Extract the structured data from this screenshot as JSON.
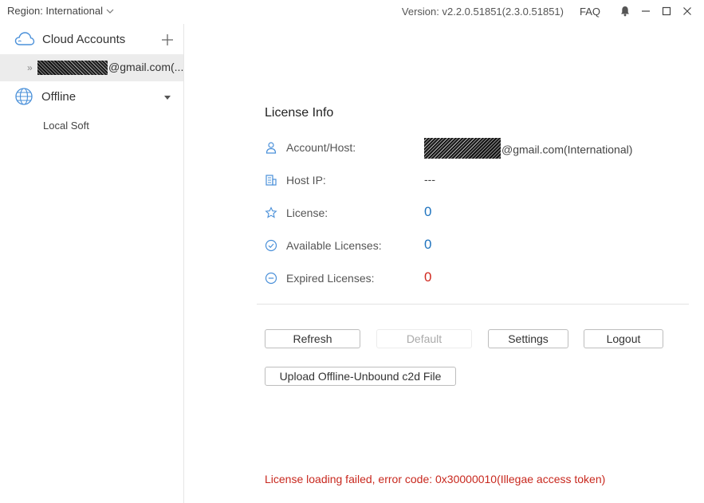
{
  "topbar": {
    "region_label": "Region: International",
    "version_label": "Version: v2.2.0.51851(2.3.0.51851)",
    "faq_label": "FAQ"
  },
  "sidebar": {
    "cloud_accounts_label": "Cloud Accounts",
    "account_email_suffix": "@gmail.com(...",
    "offline_label": "Offline",
    "local_soft_label": "Local Soft"
  },
  "license_info": {
    "title": "License Info",
    "rows": [
      {
        "label": "Account/Host:",
        "value": "@gmail.com(International)"
      },
      {
        "label": "Host IP:",
        "value": "---"
      },
      {
        "label": "License:",
        "value": "0"
      },
      {
        "label": "Available Licenses:",
        "value": "0"
      },
      {
        "label": "Expired Licenses:",
        "value": "0"
      }
    ]
  },
  "buttons": {
    "refresh": "Refresh",
    "default": "Default",
    "settings": "Settings",
    "logout": "Logout",
    "upload": "Upload Offline-Unbound c2d File"
  },
  "error_message": "License loading failed, error code: 0x30000010(Illegae access token)",
  "colors": {
    "value_blue": "#1e73be",
    "value_red": "#d0281e",
    "error_red": "#c8281e",
    "icon_blue": "#4a90d9"
  },
  "icons": {
    "cloud": "cloud-icon",
    "globe": "globe-icon",
    "bell": "bell-icon",
    "minimize": "minimize-icon",
    "maximize": "maximize-icon",
    "close": "close-icon",
    "user": "user-icon",
    "building": "building-icon",
    "star": "star-icon",
    "check_circle": "check-circle-icon",
    "minus_circle": "minus-circle-icon"
  }
}
